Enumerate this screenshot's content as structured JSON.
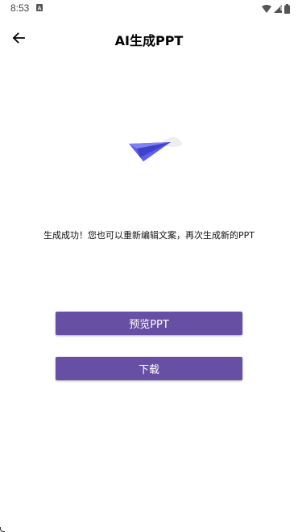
{
  "status_bar": {
    "time": "8:53",
    "icons": [
      "notification-a-icon",
      "wifi-icon",
      "signal-icon",
      "battery-icon"
    ]
  },
  "app_bar": {
    "title": "AI生成PPT",
    "back_icon": "arrow-left-icon"
  },
  "illustration": {
    "icon": "paper-plane-icon",
    "plane_color": "#5b5ef0",
    "cloud_color": "#eeeeee"
  },
  "message": "生成成功！您也可以重新编辑文案，再次生成新的PPT",
  "buttons": {
    "preview_label": "预览PPT",
    "download_label": "下载",
    "color": "#6750a4"
  }
}
